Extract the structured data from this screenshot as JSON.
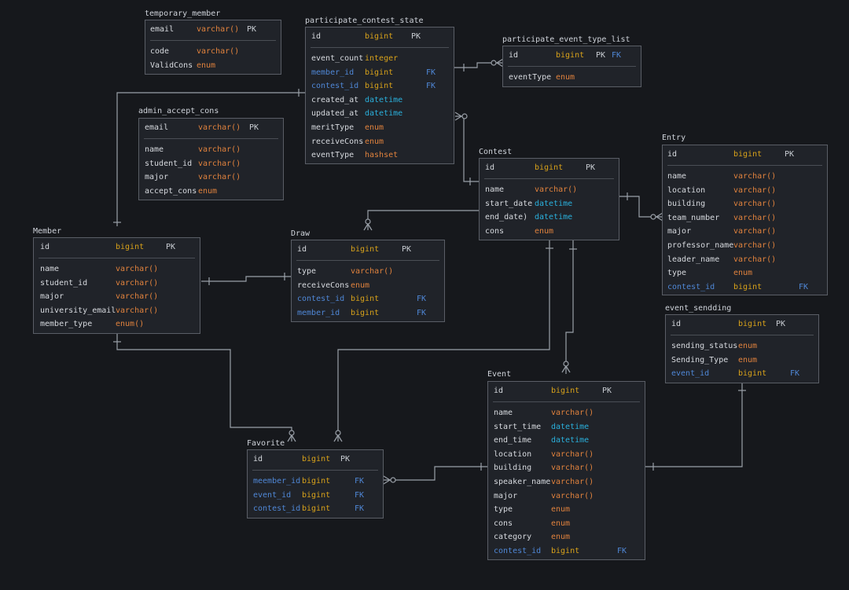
{
  "colors": {
    "background": "#16181c",
    "table_fill": "#202329",
    "border": "#5a5e66",
    "type_orange": "#e0823d",
    "type_yellow": "#d8a21a",
    "type_cyan": "#2ab0dc",
    "fk_blue": "#4f87d6"
  },
  "tables": {
    "temporary_member": {
      "title": "temporary_member",
      "rows": [
        {
          "name": "email",
          "type": "varchar()",
          "key": "PK"
        },
        {
          "name": "code",
          "type": "varchar()",
          "key": ""
        },
        {
          "name": "ValidCons",
          "type": "enum",
          "key": ""
        }
      ]
    },
    "participate_contest_state": {
      "title": "participate_contest_state",
      "rows": [
        {
          "name": "id",
          "type": "bigint",
          "key": "PK"
        },
        {
          "name": "event_count",
          "type": "integer",
          "key": ""
        },
        {
          "name": "member_id",
          "type": "bigint",
          "key": "FK"
        },
        {
          "name": "contest_id",
          "type": "bigint",
          "key": "FK"
        },
        {
          "name": "created_at",
          "type": "datetime",
          "key": ""
        },
        {
          "name": "updated_at",
          "type": "datetime",
          "key": ""
        },
        {
          "name": "meritType",
          "type": "enum",
          "key": ""
        },
        {
          "name": "receiveCons",
          "type": "enum",
          "key": ""
        },
        {
          "name": "eventType",
          "type": "hashset",
          "key": ""
        }
      ]
    },
    "participate_event_type_list": {
      "title": "participate_event_type_list",
      "rows": [
        {
          "name": "id",
          "type": "bigint",
          "key": "PK",
          "fk": "FK"
        },
        {
          "name": "eventType",
          "type": "enum",
          "key": ""
        }
      ]
    },
    "admin_accept_cons": {
      "title": "admin_accept_cons",
      "rows": [
        {
          "name": "email",
          "type": "varchar()",
          "key": "PK"
        },
        {
          "name": "name",
          "type": "varchar()",
          "key": ""
        },
        {
          "name": "student_id",
          "type": "varchar()",
          "key": ""
        },
        {
          "name": "major",
          "type": "varchar()",
          "key": ""
        },
        {
          "name": "accept_cons",
          "type": "enum",
          "key": ""
        }
      ]
    },
    "contest": {
      "title": "Contest",
      "rows": [
        {
          "name": "id",
          "type": "bigint",
          "key": "PK"
        },
        {
          "name": "name",
          "type": "varchar()",
          "key": ""
        },
        {
          "name": "start_date",
          "type": "datetime",
          "key": ""
        },
        {
          "name": "end_date)",
          "type": "datetime",
          "key": ""
        },
        {
          "name": "cons",
          "type": "enum",
          "key": ""
        }
      ]
    },
    "entry": {
      "title": "Entry",
      "rows": [
        {
          "name": "id",
          "type": "bigint",
          "key": "PK"
        },
        {
          "name": "name",
          "type": "varchar()",
          "key": ""
        },
        {
          "name": "location",
          "type": "varchar()",
          "key": ""
        },
        {
          "name": "building",
          "type": "varchar()",
          "key": ""
        },
        {
          "name": "team_number",
          "type": "varchar()",
          "key": ""
        },
        {
          "name": "major",
          "type": "varchar()",
          "key": ""
        },
        {
          "name": "professor_name",
          "type": "varchar()",
          "key": ""
        },
        {
          "name": "leader_name",
          "type": "varchar()",
          "key": ""
        },
        {
          "name": "type",
          "type": "enum",
          "key": ""
        },
        {
          "name": "contest_id",
          "type": "bigint",
          "key": "FK"
        }
      ]
    },
    "member": {
      "title": "Member",
      "rows": [
        {
          "name": "id",
          "type": "bigint",
          "key": "PK"
        },
        {
          "name": "name",
          "type": "varchar()",
          "key": ""
        },
        {
          "name": "student_id",
          "type": "varchar()",
          "key": ""
        },
        {
          "name": "major",
          "type": "varchar()",
          "key": ""
        },
        {
          "name": "university_email",
          "type": "varchar()",
          "key": ""
        },
        {
          "name": "member_type",
          "type": "enum()",
          "key": ""
        }
      ]
    },
    "draw": {
      "title": "Draw",
      "rows": [
        {
          "name": "id",
          "type": "bigint",
          "key": "PK"
        },
        {
          "name": "type",
          "type": "varchar()",
          "key": ""
        },
        {
          "name": "receiveCons",
          "type": "enum",
          "key": ""
        },
        {
          "name": "contest_id",
          "type": "bigint",
          "key": "FK"
        },
        {
          "name": "member_id",
          "type": "bigint",
          "key": "FK"
        }
      ]
    },
    "event_sendding": {
      "title": "event_sendding",
      "rows": [
        {
          "name": "id",
          "type": "bigint",
          "key": "PK"
        },
        {
          "name": "sending_status",
          "type": "enum",
          "key": ""
        },
        {
          "name": "Sending_Type",
          "type": "enum",
          "key": ""
        },
        {
          "name": "event_id",
          "type": "bigint",
          "key": "FK"
        }
      ]
    },
    "favorite": {
      "title": "Favorite",
      "rows": [
        {
          "name": "id",
          "type": "bigint",
          "key": "PK"
        },
        {
          "name": "meember_id",
          "type": "bigint",
          "key": "FK"
        },
        {
          "name": "event_id",
          "type": "bigint",
          "key": "FK"
        },
        {
          "name": "contest_id",
          "type": "bigint",
          "key": "FK"
        }
      ]
    },
    "event": {
      "title": "Event",
      "rows": [
        {
          "name": "id",
          "type": "bigint",
          "key": "PK"
        },
        {
          "name": "name",
          "type": "varchar()",
          "key": ""
        },
        {
          "name": "start_time",
          "type": "datetime",
          "key": ""
        },
        {
          "name": "end_time",
          "type": "datetime",
          "key": ""
        },
        {
          "name": "location",
          "type": "varchar()",
          "key": ""
        },
        {
          "name": "building",
          "type": "varchar()",
          "key": ""
        },
        {
          "name": "speaker_name",
          "type": "varchar()",
          "key": ""
        },
        {
          "name": "major",
          "type": "varchar()",
          "key": ""
        },
        {
          "name": "type",
          "type": "enum",
          "key": ""
        },
        {
          "name": "cons",
          "type": "enum",
          "key": ""
        },
        {
          "name": "category",
          "type": "enum",
          "key": ""
        },
        {
          "name": "contest_id",
          "type": "bigint",
          "key": "FK"
        }
      ]
    }
  }
}
